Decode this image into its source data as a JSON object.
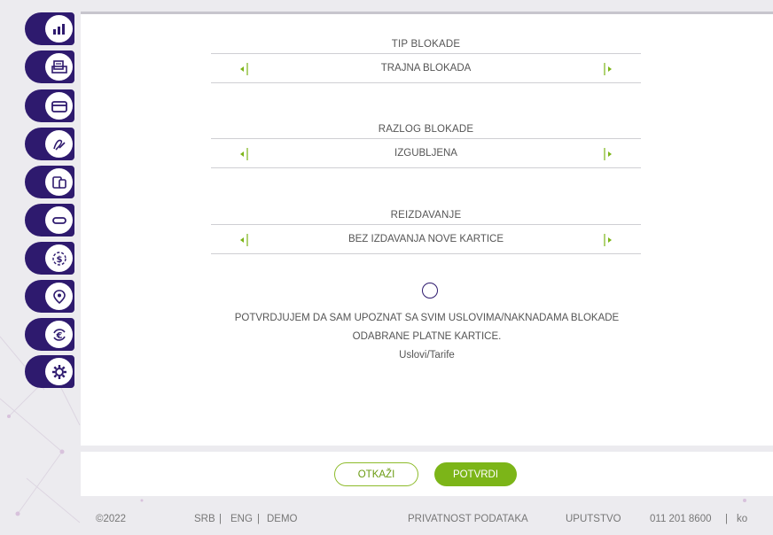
{
  "sidebar": {
    "items": [
      {
        "icon": "chart-icon"
      },
      {
        "icon": "printer-icon"
      },
      {
        "icon": "card-icon"
      },
      {
        "icon": "signature-icon"
      },
      {
        "icon": "devices-icon"
      },
      {
        "icon": "card-slim-icon"
      },
      {
        "icon": "dollar-exchange-icon"
      },
      {
        "icon": "location-icon"
      },
      {
        "icon": "euro-exchange-icon"
      },
      {
        "icon": "gear-icon"
      }
    ]
  },
  "block_type": {
    "title": "TIP BLOKADE",
    "value": "TRAJNA BLOKADA"
  },
  "block_reason": {
    "title": "RAZLOG BLOKADE",
    "value": "IZGUBLJENA"
  },
  "reissue": {
    "title": "REIZDAVANJE",
    "value": "BEZ IZDAVANJA NOVE KARTICE"
  },
  "confirm": {
    "line1": "POTVRDJUJEM DA SAM UPOZNAT SA SVIM USLOVIMA/NAKNADAMA BLOKADE",
    "line2": "ODABRANE PLATNE KARTICE.",
    "terms_link": "Uslovi/Tarife"
  },
  "actions": {
    "cancel": "OTKAŽI",
    "confirm": "POTVRDI"
  },
  "footer": {
    "copyright": "©2022",
    "lang_srb": "SRB",
    "lang_eng": "ENG",
    "demo": "DEMO",
    "sep": "|",
    "privacy": "PRIVATNOST PODATAKA",
    "guide": "UPUTSTVO",
    "phone": "011 201 8600",
    "contact": "ko"
  },
  "colors": {
    "brand_purple": "#2e1a6e",
    "accent_green": "#7cb518"
  }
}
